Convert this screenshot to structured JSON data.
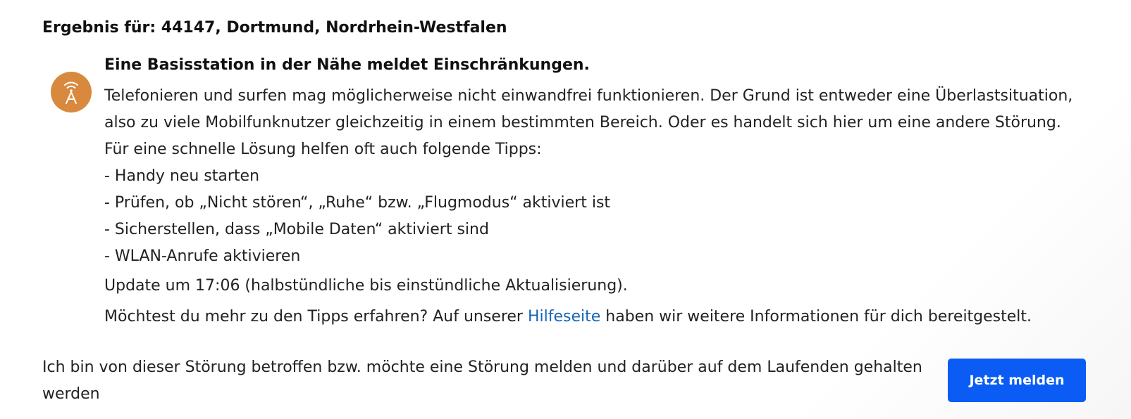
{
  "result": {
    "heading": "Ergebnis für: 44147, Dortmund, Nordrhein-Westfalen"
  },
  "status": {
    "icon": "antenna-tower-icon",
    "icon_color": "#d9893d",
    "title": "Eine Basisstation in der Nähe meldet Einschränkungen.",
    "description": "Telefonieren und surfen mag möglicherweise nicht einwandfrei funktionieren. Der Grund ist entweder eine Überlastsituation, also zu viele Mobilfunknutzer gleichzeitig in einem bestimmten Bereich. Oder es handelt sich hier um eine andere Störung.",
    "tips_intro": "Für eine schnelle Lösung helfen oft auch folgende Tipps:",
    "tips": [
      "- Handy neu starten",
      "- Prüfen, ob „Nicht stören“, „Ruhe“ bzw. „Flugmodus“ aktiviert ist",
      "- Sicherstellen, dass „Mobile Daten“ aktiviert sind",
      "- WLAN-Anrufe aktivieren"
    ],
    "update": "Update um 17:06 (halbstündliche bis einstündliche Aktualisierung).",
    "more_info_prefix": "Möchtest du mehr zu den Tipps erfahren? Auf unserer ",
    "help_link": "Hilfeseite",
    "more_info_suffix": " haben wir weitere Informationen für dich bereitgestelt."
  },
  "report": {
    "text": "Ich bin von dieser Störung betroffen bzw. möchte eine Störung melden und darüber auf dem Laufenden gehalten werden",
    "button_label": "Jetzt melden",
    "button_color": "#0a5cf5"
  }
}
